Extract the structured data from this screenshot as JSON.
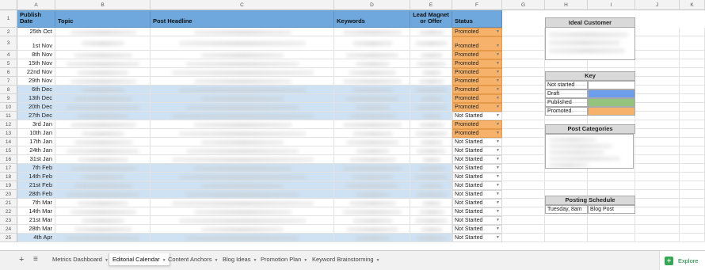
{
  "columns": [
    "A",
    "B",
    "C",
    "D",
    "E",
    "F",
    "G",
    "H",
    "I",
    "J",
    "K"
  ],
  "rownums": [
    "1",
    "2",
    "3",
    "4",
    "5",
    "6",
    "7",
    "8",
    "9",
    "10",
    "11",
    "12",
    "13",
    "14",
    "15",
    "16",
    "17",
    "18",
    "19",
    "20",
    "21",
    "22",
    "23",
    "24",
    "25"
  ],
  "header": {
    "publish_date": "Publish Date",
    "topic": "Topic",
    "headline": "Post Headline",
    "keywords": "Keywords",
    "lead_magnet": "Lead Magnet or Offer",
    "status": "Status"
  },
  "rows": [
    {
      "date": "25th Oct",
      "status": "Promoted",
      "hl": false
    },
    {
      "date": "1st Nov",
      "status": "Promoted",
      "hl": false
    },
    {
      "date": "8th Nov",
      "status": "Promoted",
      "hl": false
    },
    {
      "date": "15th Nov",
      "status": "Promoted",
      "hl": false
    },
    {
      "date": "22nd Nov",
      "status": "Promoted",
      "hl": false
    },
    {
      "date": "29th Nov",
      "status": "Promoted",
      "hl": false
    },
    {
      "date": "6th Dec",
      "status": "Promoted",
      "hl": true
    },
    {
      "date": "13th Dec",
      "status": "Promoted",
      "hl": true
    },
    {
      "date": "20th Dec",
      "status": "Promoted",
      "hl": true
    },
    {
      "date": "27th Dec",
      "status": "Not Started",
      "hl": true
    },
    {
      "date": "3rd Jan",
      "status": "Promoted",
      "hl": false
    },
    {
      "date": "10th Jan",
      "status": "Promoted",
      "hl": false
    },
    {
      "date": "17th Jan",
      "status": "Not Started",
      "hl": false
    },
    {
      "date": "24th Jan",
      "status": "Not Started",
      "hl": false
    },
    {
      "date": "31st Jan",
      "status": "Not Started",
      "hl": false
    },
    {
      "date": "7th Feb",
      "status": "Not Started",
      "hl": true
    },
    {
      "date": "14th Feb",
      "status": "Not Started",
      "hl": true
    },
    {
      "date": "21st Feb",
      "status": "Not Started",
      "hl": true
    },
    {
      "date": "28th Feb",
      "status": "Not Started",
      "hl": true
    },
    {
      "date": "7th Mar",
      "status": "Not Started",
      "hl": false
    },
    {
      "date": "14th Mar",
      "status": "Not Started",
      "hl": false
    },
    {
      "date": "21st Mar",
      "status": "Not Started",
      "hl": false
    },
    {
      "date": "28th Mar",
      "status": "Not Started",
      "hl": false
    },
    {
      "date": "4th Apr",
      "status": "Not Started",
      "hl": true
    }
  ],
  "ideal_customer": {
    "title": "Ideal Customer"
  },
  "key": {
    "title": "Key",
    "items": [
      {
        "label": "Not started",
        "color": "#ffffff"
      },
      {
        "label": "Draft",
        "color": "#6d9eeb"
      },
      {
        "label": "Published",
        "color": "#93c47d"
      },
      {
        "label": "Promoted",
        "color": "#f6b26b"
      }
    ]
  },
  "post_categories": {
    "title": "Post Categories"
  },
  "posting_schedule": {
    "title": "Posting Schedule",
    "day": "Tuesday, 8am",
    "type": "Blog Post"
  },
  "tabs": [
    "Metrics Dashboard",
    "Editorial Calendar",
    "Content Anchors",
    "Blog Ideas",
    "Promotion Plan",
    "Keyword Brainstorming"
  ],
  "active_tab": "Editorial Calendar",
  "explore_label": "Explore",
  "colors": {
    "header_blue": "#6fa8dc",
    "row_highlight": "#cfe2f3",
    "promoted": "#f6b26b"
  }
}
